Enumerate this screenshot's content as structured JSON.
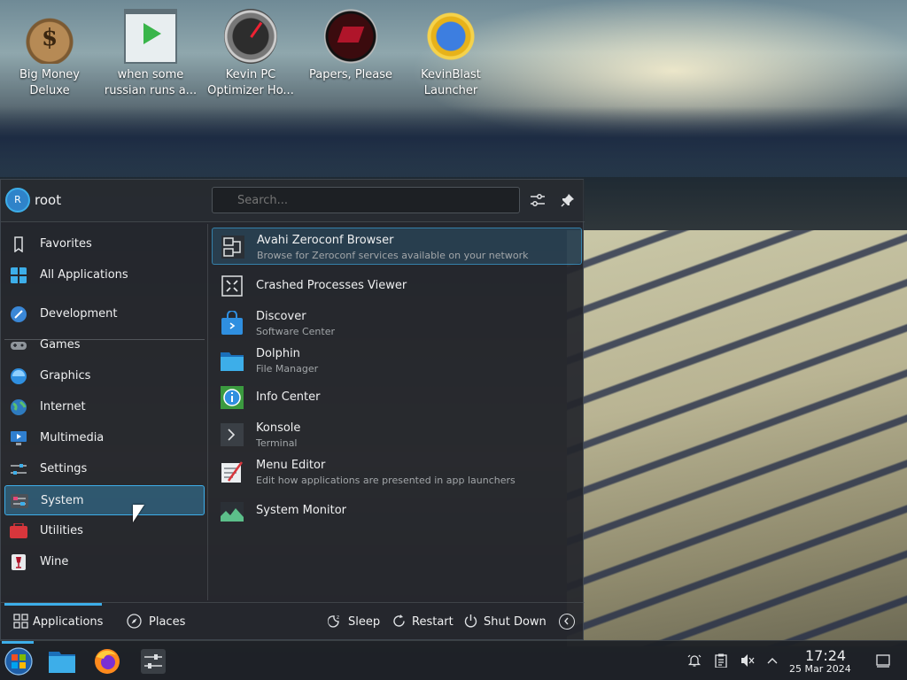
{
  "desktop": {
    "icons": [
      {
        "label": "Big Money\nDeluxe",
        "icon": "money-bag-icon"
      },
      {
        "label": "when some\nrussian runs a...",
        "icon": "video-player-icon"
      },
      {
        "label": "Kevin PC\nOptimizer Ho...",
        "icon": "gauge-icon"
      },
      {
        "label": "Papers, Please",
        "icon": "papers-please-icon"
      },
      {
        "label": "KevinBlast\nLauncher",
        "icon": "starburst-globe-icon"
      }
    ]
  },
  "menu": {
    "user": {
      "avatar_letter": "R",
      "name": "root"
    },
    "search": {
      "placeholder": "Search..."
    },
    "header_buttons": [
      {
        "icon": "configure-icon"
      },
      {
        "icon": "pin-icon"
      }
    ],
    "sidebar": [
      {
        "label": "Favorites",
        "icon": "bookmark-icon"
      },
      {
        "label": "All Applications",
        "icon": "grid-icon"
      },
      {
        "label": "Development",
        "icon": "development-icon"
      },
      {
        "label": "Games",
        "icon": "gamepad-icon"
      },
      {
        "label": "Graphics",
        "icon": "graphics-icon"
      },
      {
        "label": "Internet",
        "icon": "globe-icon"
      },
      {
        "label": "Multimedia",
        "icon": "multimedia-icon"
      },
      {
        "label": "Settings",
        "icon": "settings-icon"
      },
      {
        "label": "System",
        "icon": "system-icon",
        "selected": true
      },
      {
        "label": "Utilities",
        "icon": "utilities-icon"
      },
      {
        "label": "Wine",
        "icon": "wine-icon"
      }
    ],
    "apps": [
      {
        "name": "Avahi Zeroconf Browser",
        "description": "Browse for Zeroconf services available on your network",
        "icon": "network-icon",
        "highlighted": true
      },
      {
        "name": "Crashed Processes Viewer",
        "description": "",
        "icon": "crash-icon"
      },
      {
        "name": "Discover",
        "description": "Software Center",
        "icon": "shopping-bag-icon"
      },
      {
        "name": "Dolphin",
        "description": "File Manager",
        "icon": "folder-icon"
      },
      {
        "name": "Info Center",
        "description": "",
        "icon": "info-icon"
      },
      {
        "name": "Konsole",
        "description": "Terminal",
        "icon": "terminal-icon"
      },
      {
        "name": "Menu Editor",
        "description": "Edit how applications are presented in app launchers",
        "icon": "menu-editor-icon"
      },
      {
        "name": "System Monitor",
        "description": "",
        "icon": "system-monitor-icon"
      }
    ],
    "footer": {
      "tabs": [
        {
          "label": "Applications",
          "icon": "applications-grid-icon",
          "active": true
        },
        {
          "label": "Places",
          "icon": "compass-icon"
        }
      ],
      "power": [
        {
          "label": "Sleep",
          "icon": "sleep-icon"
        },
        {
          "label": "Restart",
          "icon": "restart-icon"
        },
        {
          "label": "Shut Down",
          "icon": "power-icon"
        }
      ],
      "more_icon": "chevron-left-icon"
    }
  },
  "taskbar": {
    "launchers": [
      {
        "icon": "start-menu-icon"
      },
      {
        "icon": "file-manager-icon"
      },
      {
        "icon": "firefox-icon"
      },
      {
        "icon": "system-settings-icon"
      }
    ],
    "tray": [
      {
        "icon": "notifications-icon"
      },
      {
        "icon": "clipboard-icon"
      },
      {
        "icon": "volume-muted-icon"
      },
      {
        "icon": "chevron-up-icon"
      }
    ],
    "clock": {
      "time": "17:24",
      "date": "25 Mar 2024"
    },
    "show_desktop_icon": "show-desktop-icon"
  },
  "colors": {
    "accent": "#3daee9",
    "menu_bg": "#23262c",
    "taskbar_bg": "#1e2126"
  }
}
